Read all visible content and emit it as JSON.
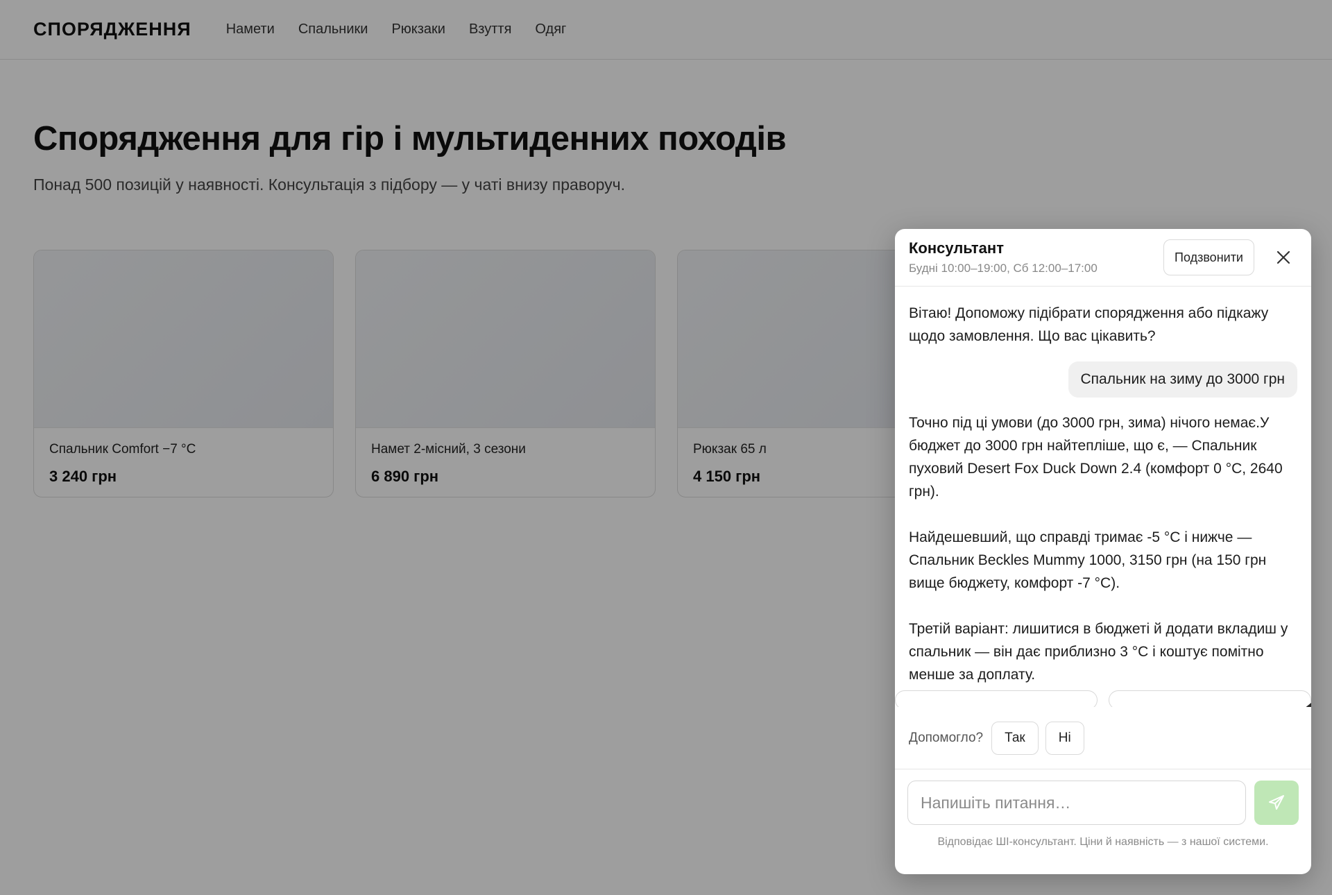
{
  "header": {
    "logo": "СПОРЯДЖЕННЯ",
    "nav": [
      "Намети",
      "Спальники",
      "Рюкзаки",
      "Взуття",
      "Одяг"
    ]
  },
  "hero": {
    "title": "Спорядження для гір і мультиденних походів",
    "subtitle": "Понад 500 позицій у наявності. Консультація з підбору — у чаті внизу праворуч."
  },
  "products": [
    {
      "name": "Спальник Comfort −7 °C",
      "price": "3 240 грн"
    },
    {
      "name": "Намет 2-місний, 3 сезони",
      "price": "6 890 грн"
    },
    {
      "name": "Рюкзак 65 л",
      "price": "4 150 грн"
    }
  ],
  "chat": {
    "title": "Консультант",
    "hours": "Будні 10:00–19:00, Сб 12:00–17:00",
    "call_label": "Подзвонити",
    "messages": {
      "bot_greeting": "Вітаю! Допоможу підібрати спорядження або підкажу щодо замовлення. Що вас цікавить?",
      "user_query": "Спальник на зиму до 3000 грн",
      "bot_answer_1": "Точно під ці умови (до 3000 грн, зима) нічого немає.У бюджет до 3000 грн найтепліше, що є, — Спальник пуховий Desert Fox Duck Down 2.4 (комфорт 0 °C, 2640 грн).",
      "bot_answer_2": "Найдешевший, що справді тримає -5 °C і нижче — Спальник Beckles Mummy 1000, 3150 грн (на 150 грн вище бюджету, комфорт -7 °C).",
      "bot_answer_3": "Третій варіант: лишитися в бюджеті й додати вкладиш у спальник — він дає приблизно 3 °C і коштує помітно менше за доплату."
    },
    "feedback": {
      "label": "Допомогло?",
      "yes": "Так",
      "no": "Ні"
    },
    "input_placeholder": "Напишіть питання…",
    "disclaimer": "Відповідає ШІ-консультант. Ціни й наявність — з нашої системи."
  },
  "colors": {
    "send_button": "#bfe7b6",
    "overlay": "rgba(0,0,0,0.38)"
  },
  "icons": {
    "close": "close-icon",
    "send": "send-icon"
  }
}
